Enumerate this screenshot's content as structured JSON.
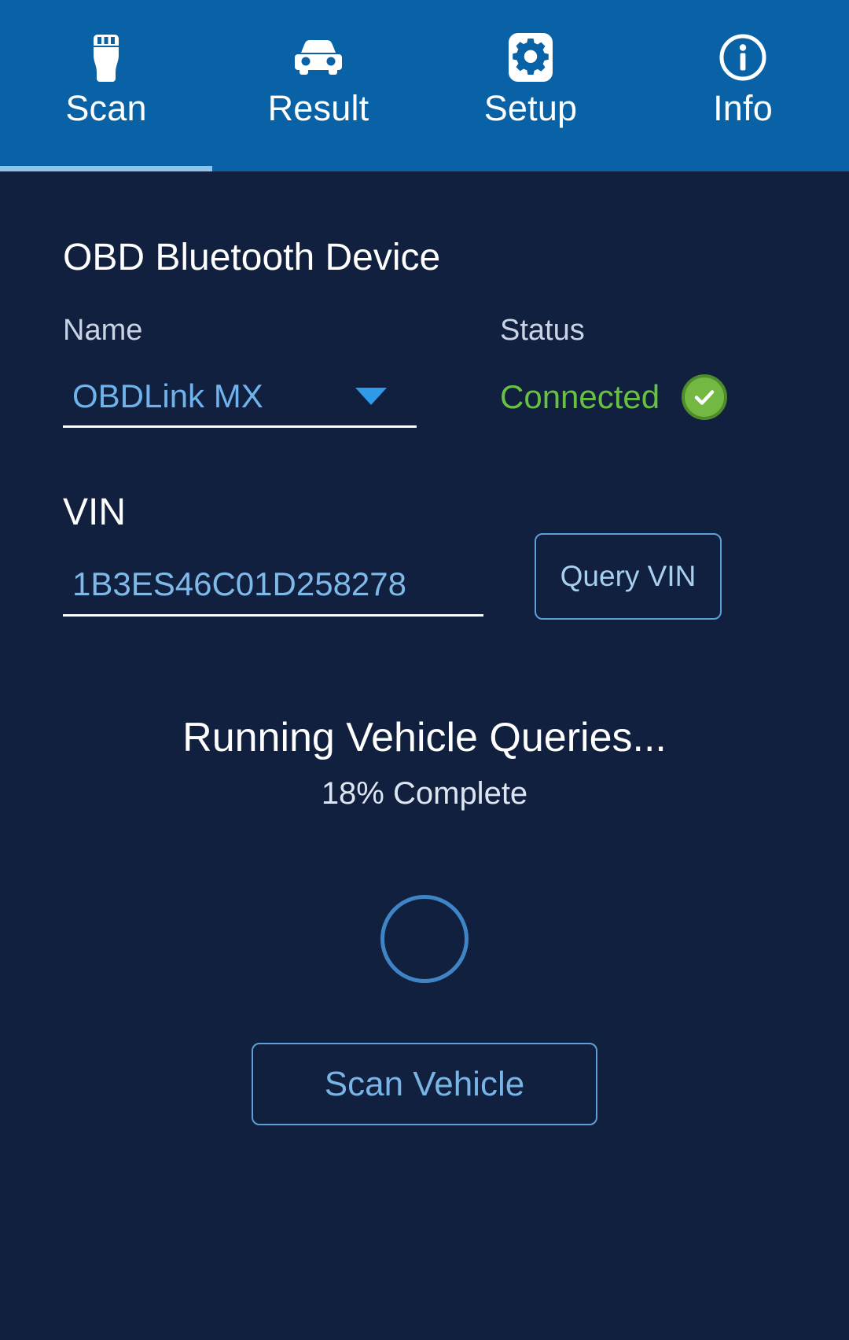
{
  "nav": {
    "tabs": [
      {
        "label": "Scan",
        "icon": "obd-plug-icon",
        "active": true
      },
      {
        "label": "Result",
        "icon": "car-icon",
        "active": false
      },
      {
        "label": "Setup",
        "icon": "gear-icon",
        "active": false
      },
      {
        "label": "Info",
        "icon": "info-circle-icon",
        "active": false
      }
    ]
  },
  "device": {
    "section_title": "OBD Bluetooth Device",
    "name_label": "Name",
    "name_value": "OBDLink MX",
    "name_caret_icon": "chevron-down-icon",
    "status_label": "Status",
    "status_value": "Connected",
    "status_icon": "check-circle-icon",
    "status_color": "#69c144"
  },
  "vin": {
    "label": "VIN",
    "value": "1B3ES46C01D258278",
    "placeholder": "VIN",
    "query_button": "Query VIN"
  },
  "progress": {
    "title": "Running Vehicle Queries...",
    "subtitle": "18% Complete",
    "percent": 18,
    "spinner_icon": "loading-spinner-icon"
  },
  "actions": {
    "scan_vehicle": "Scan Vehicle"
  },
  "colors": {
    "nav_blue": "#0a62a6",
    "body_navy": "#11203f",
    "accent_blue": "#6fb3ec",
    "outline_blue": "#5d9fd8",
    "success_green": "#72b843"
  }
}
